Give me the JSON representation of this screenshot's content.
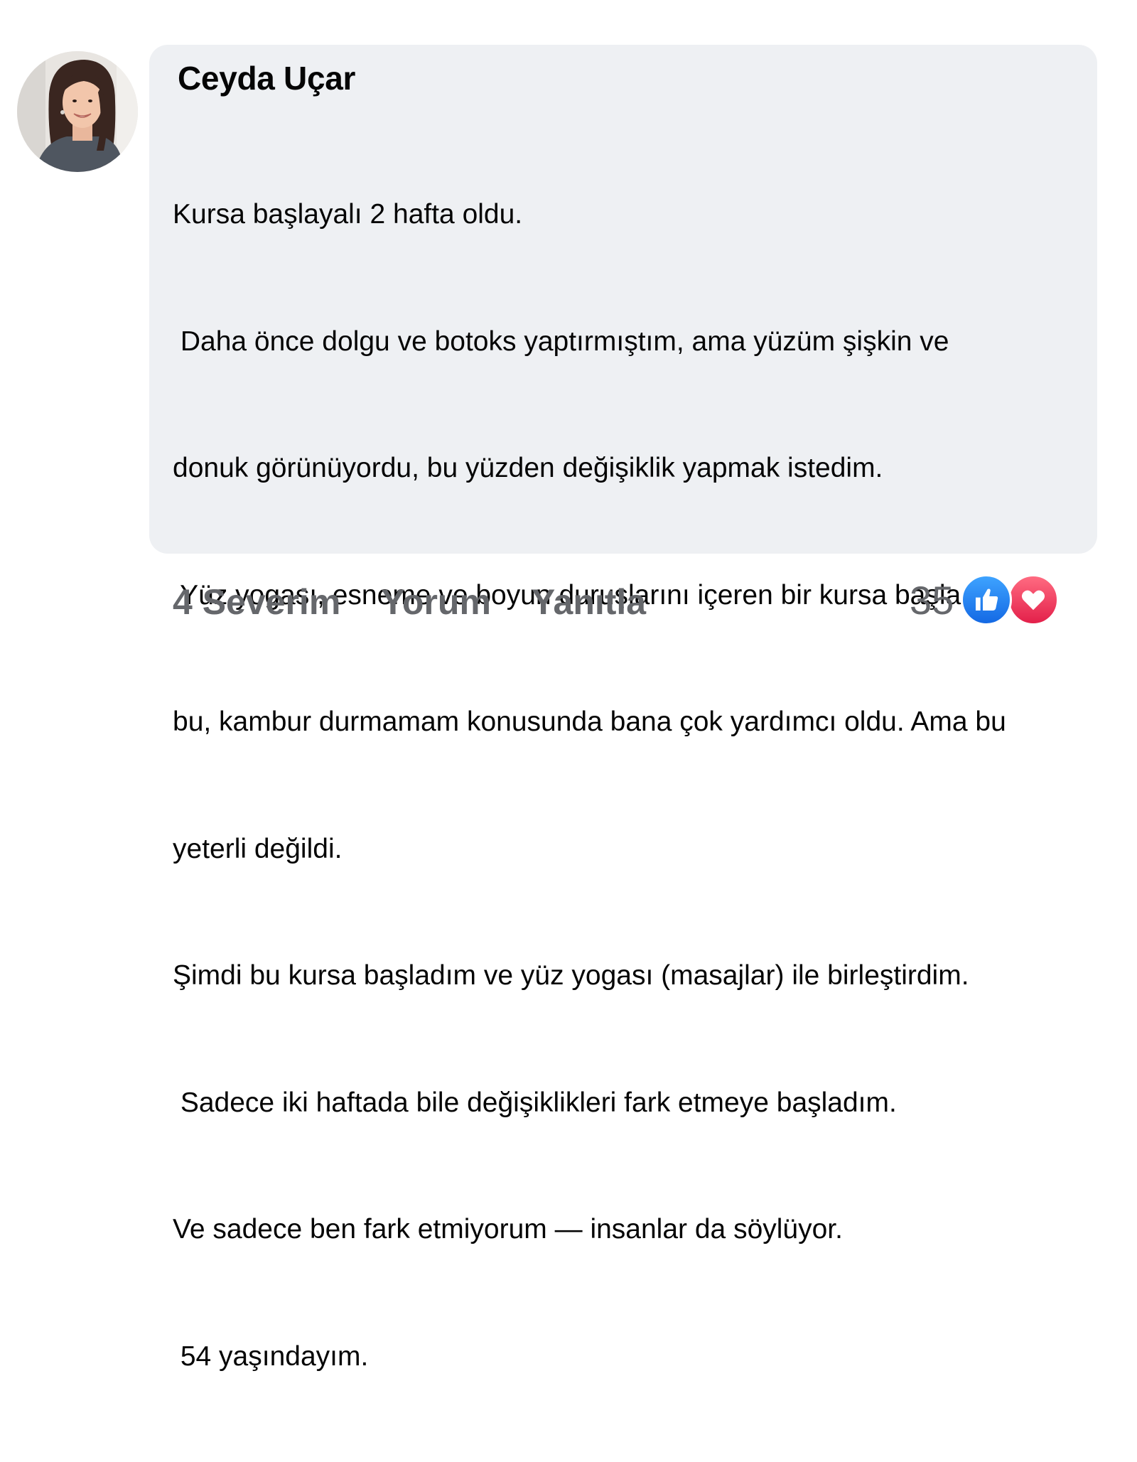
{
  "comment": {
    "author": "Ceyda Uçar",
    "lines": [
      "Kursa başlayalı 2 hafta oldu.",
      " Daha önce dolgu ve botoks yaptırmıştım, ama yüzüm şişkin ve",
      "donuk görünüyordu, bu yüzden değişiklik yapmak istedim.",
      " Yüz yogası, esneme ve boyun duruşlarını içeren bir kursa başladım;",
      "bu, kambur durmamam konusunda bana çok yardımcı oldu. Ama bu",
      "yeterli değildi.",
      "Şimdi bu kursa başladım ve yüz yogası (masajlar) ile birleştirdim.",
      " Sadece iki haftada bile değişiklikleri fark etmeye başladım.",
      "Ve sadece ben fark etmiyorum — insanlar da söylüyor.",
      " 54 yaşındayım."
    ]
  },
  "actions": {
    "like_label": "4 Severim",
    "comment_label": "Yorum",
    "reply_label": "Yanıtla"
  },
  "reactions": {
    "count": "35",
    "icons": [
      "like-icon",
      "love-icon"
    ]
  },
  "colors": {
    "bubble": "#eef0f3",
    "action_text": "#65676b",
    "like_blue": "#1877f2",
    "love_red": "#f33e58"
  }
}
